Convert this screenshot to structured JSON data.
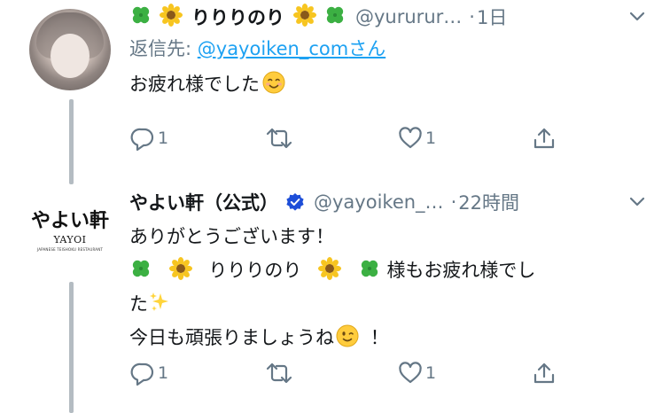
{
  "tweet1": {
    "display_name": "りりりのり",
    "handle": "@yururur…",
    "dot": "·",
    "time": "1日",
    "reply_prefix": "返信先: ",
    "reply_mention": "@yayoiken_com",
    "reply_suffix": "さん",
    "text": "お疲れ様でした",
    "actions": {
      "reply_count": "1",
      "retweet_count": "",
      "like_count": "1"
    }
  },
  "tweet2": {
    "display_name": "やよい軒（公式）",
    "handle": "@yayoiken_…",
    "dot": "·",
    "time": "22時間",
    "line1": "ありがとうございます！",
    "line2_name": "りりりのり",
    "line2_tail": "様もお疲れ様でし",
    "line3": "た",
    "line4": "今日も頑張りましょうね",
    "line4_tail": "！",
    "actions": {
      "reply_count": "1",
      "retweet_count": "",
      "like_count": "1"
    }
  },
  "logo": {
    "jp": "やよい軒",
    "en": "YAYOI",
    "sub": "JAPANESE TEISHOKU RESTAURANT"
  },
  "colors": {
    "link": "#1da1f2",
    "secondary_text": "#657786",
    "thread_line": "#b4bcc2",
    "verified": "#1d4ed8"
  },
  "icons": [
    "four-leaf-clover-icon",
    "sunflower-icon",
    "smiling-face-icon",
    "sparkles-icon",
    "winking-face-icon",
    "verified-badge-icon",
    "chevron-down-icon",
    "reply-icon",
    "retweet-icon",
    "like-icon",
    "share-icon"
  ]
}
